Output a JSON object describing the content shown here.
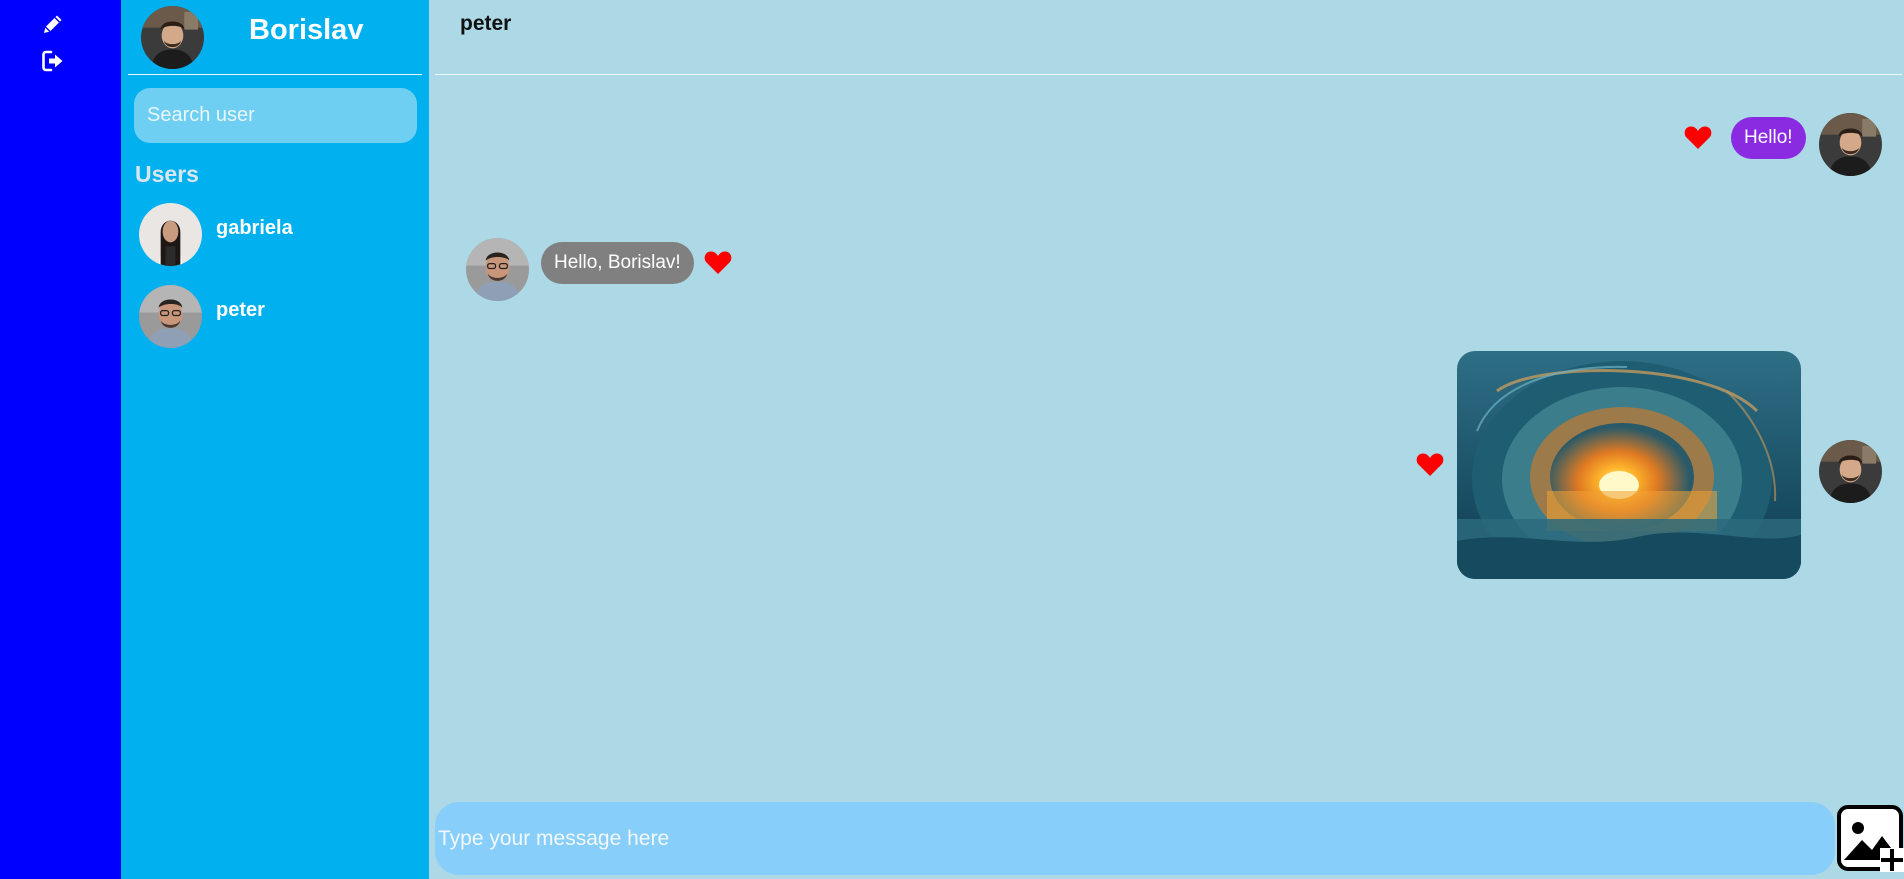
{
  "rail": {
    "icons": [
      "pencil-icon",
      "sign-out-icon"
    ]
  },
  "sidebar": {
    "current_user": "Borislav",
    "search_placeholder": "Search user",
    "users_heading": "Users",
    "users": [
      {
        "name": "gabriela"
      },
      {
        "name": "peter"
      }
    ]
  },
  "chat": {
    "title": "peter",
    "messages": [
      {
        "from": "me",
        "type": "text",
        "text": "Hello!",
        "liked": true
      },
      {
        "from": "peter",
        "type": "text",
        "text": "Hello, Borislav!",
        "liked": true
      },
      {
        "from": "me",
        "type": "image",
        "image": "ocean wave tunnel at sunset",
        "liked": true
      }
    ],
    "composer_placeholder": "Type your message here"
  },
  "colors": {
    "rail": "#0000ff",
    "sidebar": "#00b0ef",
    "chat_bg": "#add8e6",
    "my_bubble": "#8a2be2",
    "their_bubble": "#808080",
    "heart": "#ff0000",
    "composer": "#87cefa"
  }
}
